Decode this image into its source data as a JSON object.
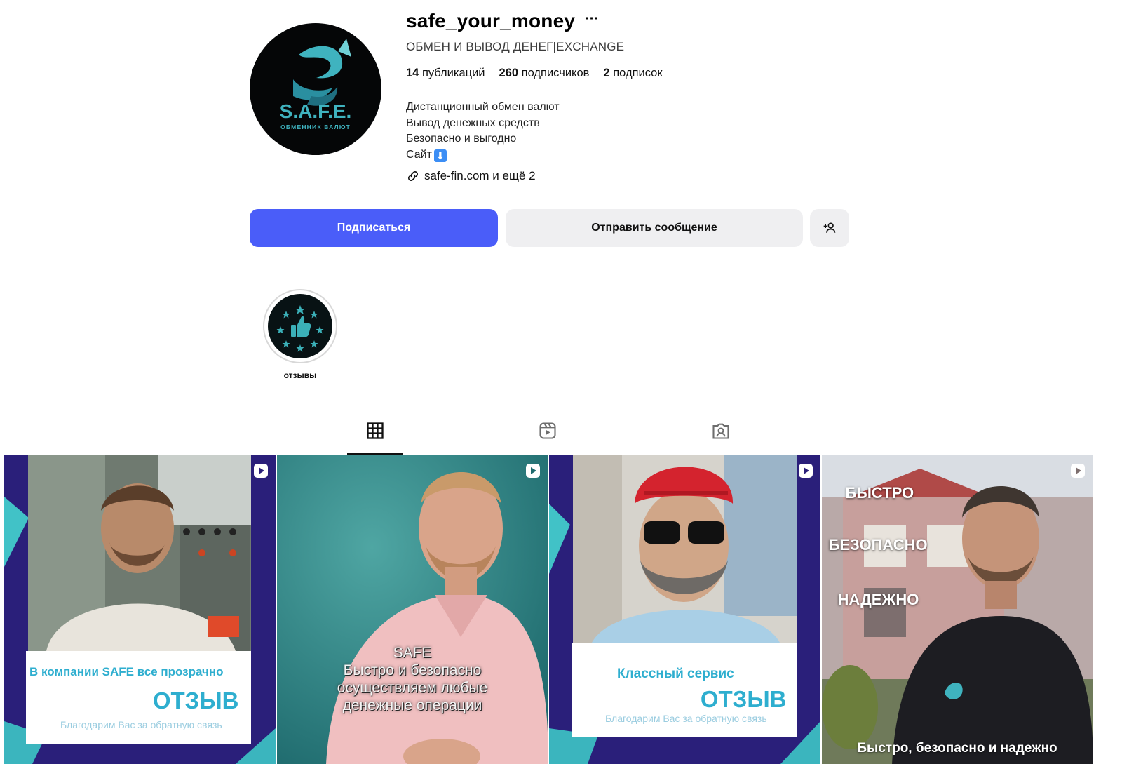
{
  "profile": {
    "username": "safe_your_money",
    "more_label": "···",
    "category": "ОБМЕН И ВЫВОД ДЕНЕГ|EXCHANGE",
    "avatar_brand": "S.A.F.E.",
    "avatar_tagline": "ОБМЕННИК ВАЛЮТ",
    "stats": {
      "posts_count": "14",
      "posts_label": "публикаций",
      "followers_count": "260",
      "followers_label": "подписчиков",
      "following_count": "2",
      "following_label": "подписок"
    },
    "bio": {
      "line1": "Дистанционный обмен валют",
      "line2": "Вывод денежных средств",
      "line3": "Безопасно и выгодно",
      "line4": "Сайт",
      "emoji": "⬇"
    },
    "link_text": "safe-fin.com и ещё 2"
  },
  "actions": {
    "follow": "Подписаться",
    "message": "Отправить сообщение",
    "suggest_icon": "add-person-icon"
  },
  "highlights": [
    {
      "label": "отзывы",
      "icon": "thumbs-up-stars-icon"
    }
  ],
  "tabs": [
    {
      "name": "posts",
      "icon": "grid-icon",
      "active": true
    },
    {
      "name": "reels",
      "icon": "reels-icon",
      "active": false
    },
    {
      "name": "tagged",
      "icon": "tagged-icon",
      "active": false
    }
  ],
  "posts": [
    {
      "type": "reel",
      "title": "В компании SAFE все прозрачно",
      "big": "ОТЗЫВ",
      "small": "Благодарим Вас за обратную связь"
    },
    {
      "type": "reel",
      "overlay_line1": "SAFE",
      "overlay_line2": "Быстро и безопасно",
      "overlay_line3": "осуществляем любые",
      "overlay_line4": "денежные операции"
    },
    {
      "type": "reel",
      "title": "Классный сервис",
      "big": "ОТЗЫВ",
      "small": "Благодарим Вас за обратную связь"
    },
    {
      "type": "reel",
      "word1": "БЫСТРО",
      "word2": "БЕЗОПАСНО",
      "word3": "НАДЕЖНО",
      "bottom": "Быстро, безопасно и надежно"
    }
  ],
  "colors": {
    "accent_button": "#4a5df9",
    "secondary_button": "#efeff1",
    "brand_teal": "#2eaecf",
    "card_background": "#2a1f7a"
  }
}
